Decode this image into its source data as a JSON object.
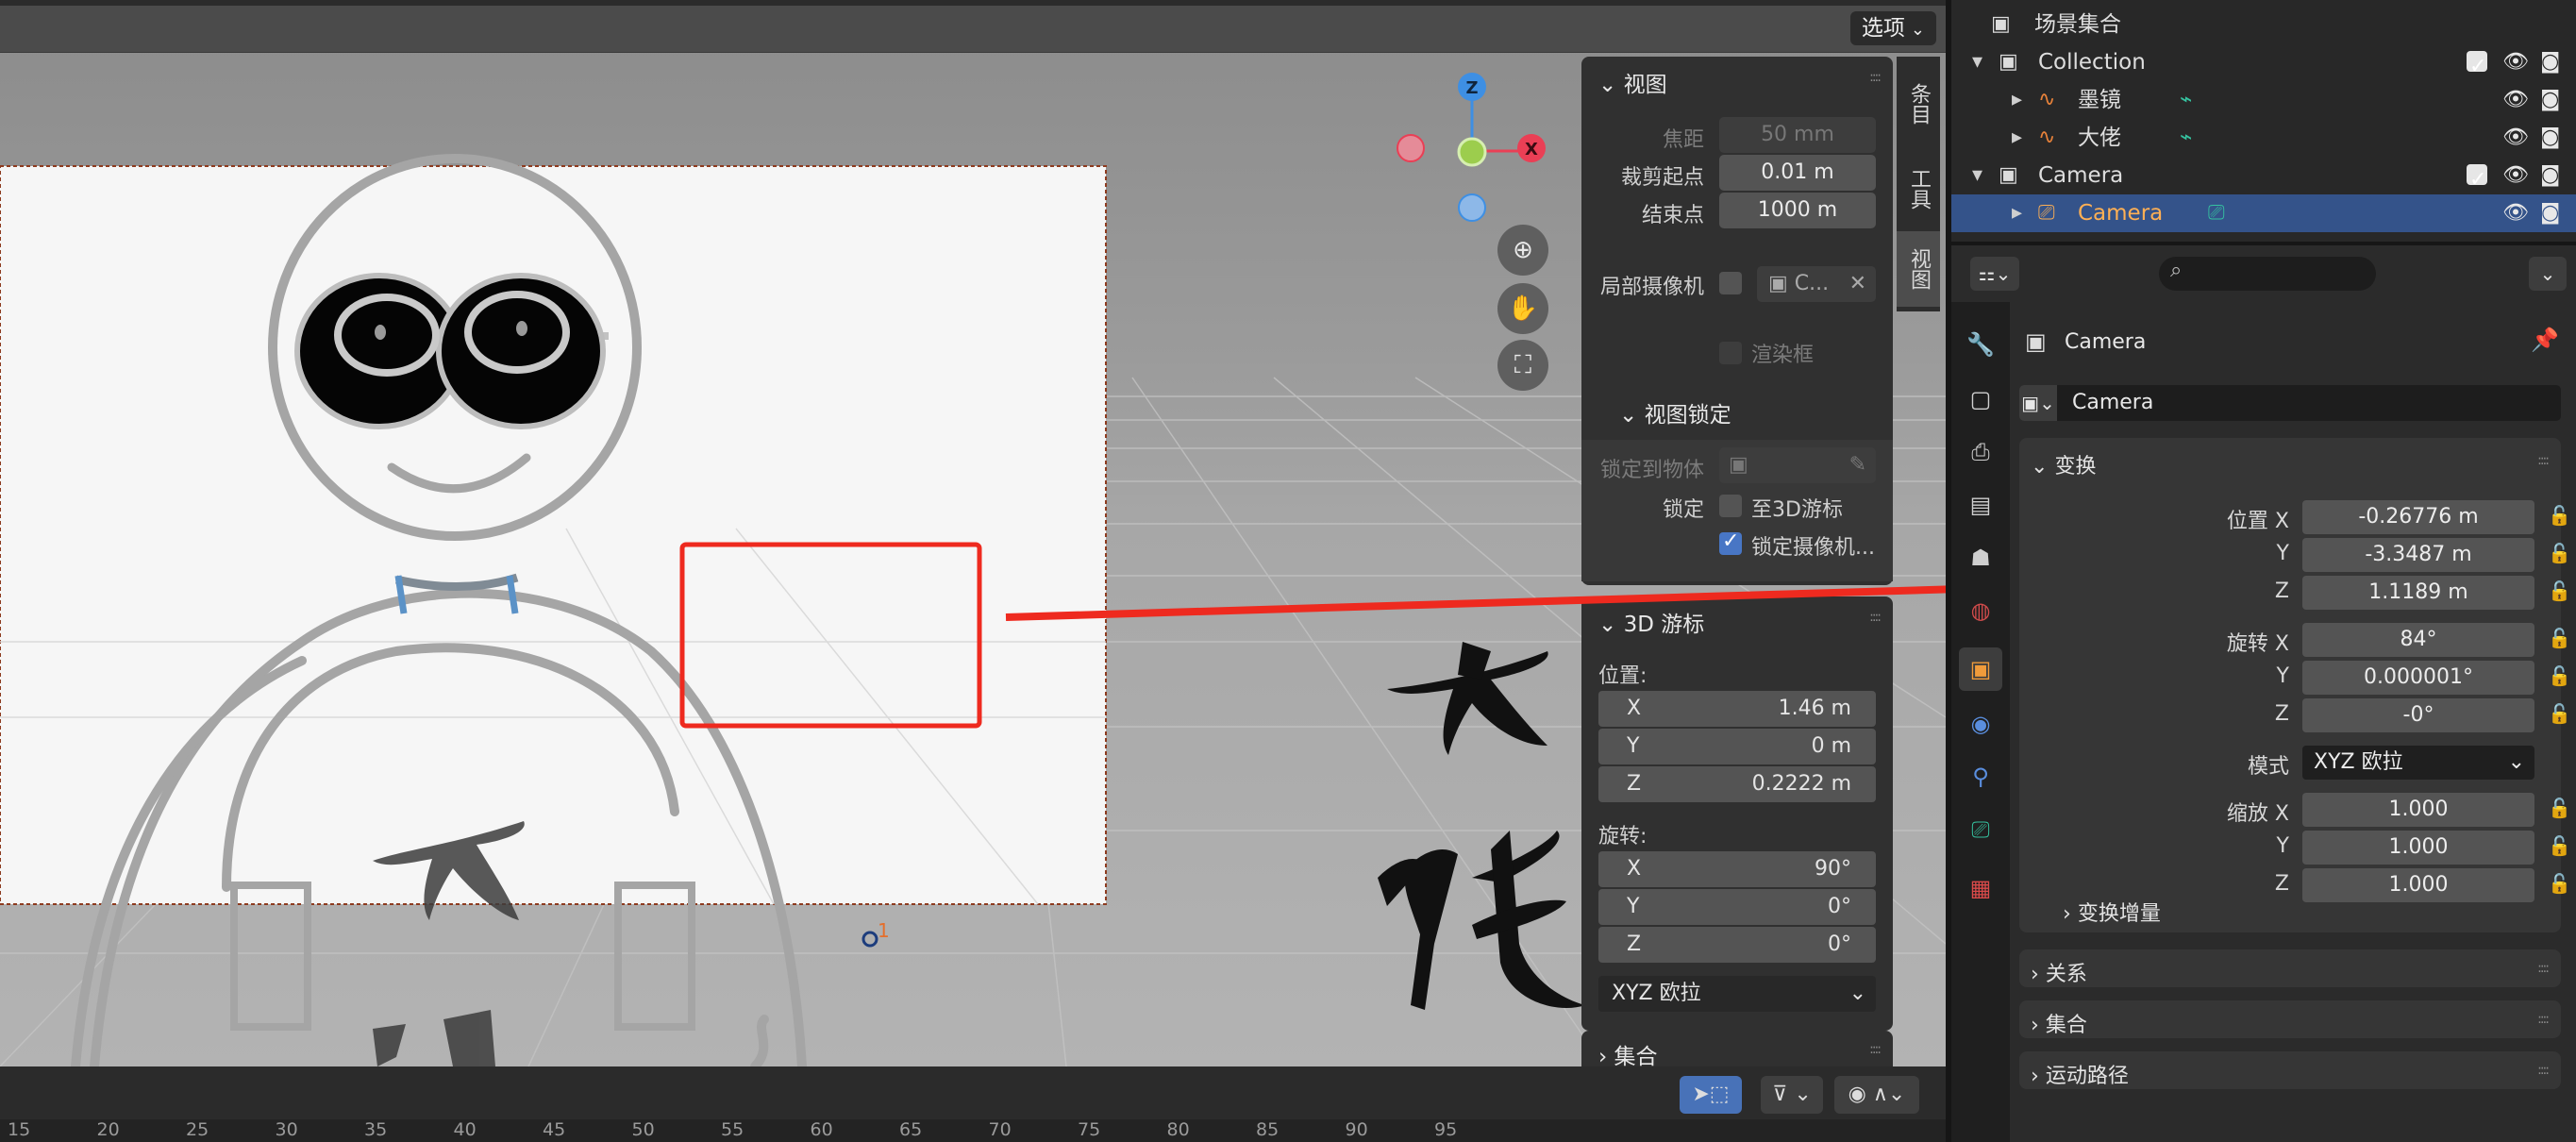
{
  "viewport": {
    "options_label": "选项",
    "tabs": [
      "条目",
      "工具",
      "视图"
    ],
    "gizmo_axes": [
      "Z",
      "X"
    ],
    "cursor_marker": "1"
  },
  "npanel": {
    "view": {
      "title": "视图",
      "focal_label": "焦距",
      "focal_value": "50 mm",
      "clip_start_label": "裁剪起点",
      "clip_start_value": "0.01 m",
      "clip_end_label": "结束点",
      "clip_end_value": "1000 m",
      "local_camera_label": "局部摄像机",
      "local_camera_value": "C...",
      "render_region_label": "渲染框"
    },
    "view_lock": {
      "title": "视图锁定",
      "lock_to_object_label": "锁定到物体",
      "lock_label": "锁定",
      "to_3d_cursor_label": "至3D游标",
      "lock_camera_label": "锁定摄像机..."
    },
    "cursor3d": {
      "title": "3D 游标",
      "location_label": "位置:",
      "loc": [
        {
          "k": "X",
          "v": "1.46 m"
        },
        {
          "k": "Y",
          "v": "0 m"
        },
        {
          "k": "Z",
          "v": "0.2222 m"
        }
      ],
      "rotation_label": "旋转:",
      "rot": [
        {
          "k": "X",
          "v": "90°"
        },
        {
          "k": "Y",
          "v": "0°"
        },
        {
          "k": "Z",
          "v": "0°"
        }
      ],
      "mode_value": "XYZ 欧拉"
    },
    "collection_title": "集合"
  },
  "timeline": {
    "frames": [
      "15",
      "20",
      "25",
      "30",
      "35",
      "40",
      "45",
      "50",
      "55",
      "60",
      "65",
      "70",
      "75",
      "80",
      "85",
      "90",
      "95"
    ]
  },
  "outliner": {
    "root": "场景集合",
    "rows": [
      {
        "label": "Collection",
        "kind": "collection"
      },
      {
        "label": "墨镜",
        "kind": "gp"
      },
      {
        "label": "大佬",
        "kind": "gp"
      },
      {
        "label": "Camera",
        "kind": "collection"
      },
      {
        "label": "Camera",
        "kind": "camera"
      }
    ]
  },
  "properties": {
    "object_name": "Camera",
    "object_field": "Camera",
    "transform_title": "变换",
    "location_label": "位置 X",
    "location": [
      "-0.26776 m",
      "-3.3487 m",
      "1.1189 m"
    ],
    "rotation_label": "旋转 X",
    "rotation": [
      "84°",
      "0.000001°",
      "-0°"
    ],
    "mode_label": "模式",
    "mode_value": "XYZ 欧拉",
    "scale_label": "缩放 X",
    "scale": [
      "1.000",
      "1.000",
      "1.000"
    ],
    "axis_y": "Y",
    "axis_z": "Z",
    "delta_transform": "变换增量",
    "relations": "关系",
    "collections": "集合",
    "motion_paths": "运动路径"
  },
  "colors": {
    "accent_blue": "#4876c5",
    "selection_blue": "#34538a",
    "annotation_red": "#ee2a1f",
    "camera_orange": "#ffb054",
    "gp_orange": "#e8823a",
    "gp_green": "#35c3a0"
  }
}
